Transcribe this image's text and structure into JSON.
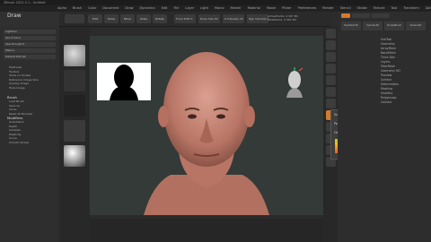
{
  "window": {
    "title": "ZBrush 2021.5.1 - Untitled"
  },
  "menus": [
    "Alpha",
    "Brush",
    "Color",
    "Document",
    "Draw",
    "Dynamics",
    "Edit",
    "File",
    "Layer",
    "Light",
    "Macro",
    "Marker",
    "Material",
    "Movie",
    "Picker",
    "Preferences",
    "Render",
    "Stencil",
    "Stroke",
    "Texture",
    "Tool",
    "Transform",
    "Zplugin",
    "Zscript"
  ],
  "menu_badge": "Menus",
  "left": {
    "title": "Draw",
    "buttons": [
      "Lightbox",
      "Quick Save",
      "See-through 0",
      "Menus",
      "Default ZScript"
    ],
    "sections": [
      {
        "label": "Brush",
        "items": [
          "Load Brush",
          "Save As",
          "Clone",
          "Reset All Brushes"
        ]
      },
      {
        "label": "Modifiers",
        "items": [
          "Orientation",
          "Depth",
          "Samples",
          "Elasticity",
          "Curve",
          "Smooth Stroke"
        ]
      }
    ],
    "reference_items": [
      "Multiview",
      "Toolbox",
      "Show on Toolbar",
      "Reference Image Size",
      "Overlay Image",
      "Tools Image"
    ]
  },
  "toolshelf": {
    "buttons": [
      "Edit",
      "Draw",
      "Move",
      "Scale",
      "Rotate"
    ],
    "sliders": [
      {
        "label": "Focal Shift",
        "value": "0"
      },
      {
        "label": "Draw Size",
        "value": "64"
      },
      {
        "label": "Z Intensity",
        "value": "25"
      },
      {
        "label": "Rgb Intensity",
        "value": "100"
      }
    ],
    "stats": [
      "ActivePoints: 2.307 Mil",
      "TotalPoints: 2.307 Mil"
    ]
  },
  "popup": {
    "items": [
      "Subdivide 5",
      "Polypaint (Poly)",
      "Object Mask (Poly)"
    ]
  },
  "right": {
    "sections": [
      "SubTool",
      "Geometry",
      "ArrayMesh",
      "NanoMesh",
      "Thick Skin",
      "Layers",
      "FiberMesh",
      "Geometry HD",
      "Preview",
      "Surface",
      "Deformation",
      "Masking",
      "Visibility",
      "Polygroups",
      "Contact"
    ],
    "tools": [
      "PolyMesh3D",
      "Cylinder3D",
      "SimpleBrush",
      "Sphere3D"
    ]
  },
  "colors": {
    "accent": "#d47a2a",
    "badge": "#c0392b",
    "canvas": "#333a38",
    "skin": "#c68a76"
  }
}
